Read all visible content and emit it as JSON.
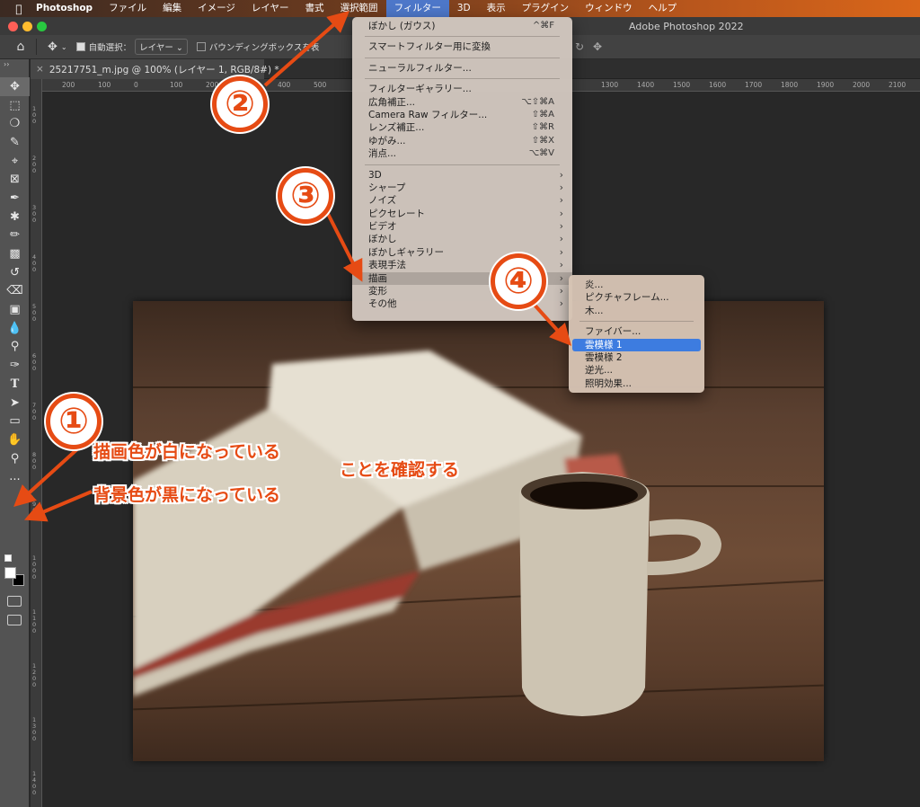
{
  "menubar": {
    "apple_icon": "apple-icon",
    "app_name": "Photoshop",
    "items": [
      "ファイル",
      "編集",
      "イメージ",
      "レイヤー",
      "書式",
      "選択範囲",
      "フィルター",
      "3D",
      "表示",
      "プラグイン",
      "ウィンドウ",
      "ヘルプ"
    ]
  },
  "titlebar": {
    "title": "Adobe Photoshop 2022"
  },
  "options": {
    "auto_select_label": "自動選択：",
    "auto_select_value": "レイヤー",
    "bounding_box_label": "バウンディングボックスを表"
  },
  "document": {
    "tab_title": "25217751_m.jpg @ 100% (レイヤー 1, RGB/8#) *",
    "close_label": "×"
  },
  "rulers": {
    "h_ticks": [
      "200",
      "100",
      "0",
      "100",
      "200",
      "300",
      "400",
      "500",
      "1300",
      "1400",
      "1500",
      "1600",
      "1700",
      "1800",
      "1900",
      "2000",
      "2100"
    ],
    "v_ticks": [
      "100",
      "200",
      "300",
      "400",
      "500",
      "600",
      "700",
      "800",
      "900",
      "1000",
      "1100",
      "1200",
      "1300",
      "1400"
    ]
  },
  "filter_menu": {
    "items": [
      {
        "label": "ぼかし (ガウス)",
        "shortcut": "^⌘F"
      },
      {
        "label": "スマートフィルター用に変換"
      },
      {
        "label": "ニューラルフィルター..."
      },
      {
        "label": "フィルターギャラリー..."
      },
      {
        "label": "広角補正...",
        "shortcut": "⌥⇧⌘A"
      },
      {
        "label": "Camera Raw フィルター...",
        "shortcut": "⇧⌘A"
      },
      {
        "label": "レンズ補正...",
        "shortcut": "⇧⌘R"
      },
      {
        "label": "ゆがみ...",
        "shortcut": "⇧⌘X"
      },
      {
        "label": "消点...",
        "shortcut": "⌥⌘V"
      },
      {
        "label": "3D"
      },
      {
        "label": "シャープ"
      },
      {
        "label": "ノイズ"
      },
      {
        "label": "ピクセレート"
      },
      {
        "label": "ビデオ"
      },
      {
        "label": "ぼかし"
      },
      {
        "label": "ぼかしギャラリー"
      },
      {
        "label": "表現手法"
      },
      {
        "label": "描画"
      },
      {
        "label": "変形"
      },
      {
        "label": "その他"
      }
    ],
    "submenu_arrow": "›"
  },
  "render_submenu": {
    "items": [
      "炎...",
      "ピクチャフレーム...",
      "木...",
      "ファイバー...",
      "雲模様 1",
      "雲模様 2",
      "逆光...",
      "照明効果..."
    ]
  },
  "annotations": {
    "step1": "①",
    "step2": "②",
    "step3": "③",
    "step4": "④",
    "note_foreground": "描画色が白になっている",
    "note_background": "背景色が黒になっている",
    "note_confirm": "ことを確認する",
    "accent_color": "#e64b14"
  },
  "tools_panel": {
    "collapse": "››",
    "more": "···"
  }
}
